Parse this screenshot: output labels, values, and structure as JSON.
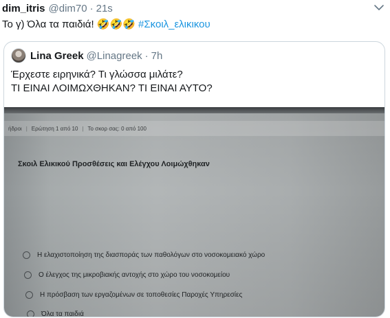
{
  "tweet": {
    "name": "dim_itris",
    "handle": "@dim70",
    "separator": "·",
    "time": "21s",
    "text": "Το γ) Όλα τα παιδιά!",
    "emoji": [
      "🤣",
      "🤣",
      "🤣"
    ],
    "hashtag": "#Σκοιλ_ελικικου",
    "menu_icon": "chevron-down-icon"
  },
  "quote": {
    "name": "Lina Greek",
    "handle": "@Linagreek",
    "separator": "·",
    "time": "7h",
    "lines": [
      "Έρχεστε ειρηνικά? Τι γλώσσα μιλάτε?",
      "ΤΙ ΕΙΝΑΙ ΛΟΙΜΩΧΘΗΚΑΝ? ΤΙ ΕΙΝΑΙ ΑΥΤΟ?"
    ],
    "photo": {
      "topbar": [
        "ήδροι",
        "|",
        "Ερώτηση 1 από 10",
        "|",
        "Το σκορ σας: 0 από 100"
      ],
      "question": "Σκοιλ Ελικικού Προσθέσεις και Ελέγχου Λοιμώχθηκαν",
      "options": [
        "Η ελαχιστοποίηση της διασποράς των παθολόγων στο νοσοκομειακό χώρο",
        "Ο έλεγχος της μικροβιακής αντοχής στο χώρο του νοσοκομείου",
        "Η πρόσβαση των εργαζομένων σε τοποθεσίες Παροχές Υπηρεσίες",
        "Όλα τα παιδιά"
      ]
    }
  }
}
